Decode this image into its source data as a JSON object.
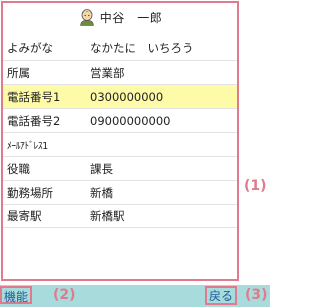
{
  "header": {
    "name": "中谷　一郎"
  },
  "fields": [
    {
      "label": "よみがな",
      "value": "なかたに　いちろう"
    },
    {
      "label": "所属",
      "value": "営業部"
    },
    {
      "label": "電話番号1",
      "value": "0300000000"
    },
    {
      "label": "電話番号2",
      "value": "09000000000"
    },
    {
      "label": "ﾒｰﾙｱﾄﾞﾚｽ1",
      "value": ""
    },
    {
      "label": "役職",
      "value": "課長"
    },
    {
      "label": "勤務場所",
      "value": "新橋"
    },
    {
      "label": "最寄駅",
      "value": "新橋駅"
    }
  ],
  "annotations": {
    "detail": "(1)",
    "function": "(2)",
    "back": "(3)"
  },
  "toolbar": {
    "function_label": "機能",
    "back_label": "戻る"
  },
  "colors": {
    "highlight_row": "#fdfaa8",
    "bottom_bar": "#a8dcdc",
    "annotation": "#e07a8c",
    "button_text": "#1b5c9a"
  }
}
